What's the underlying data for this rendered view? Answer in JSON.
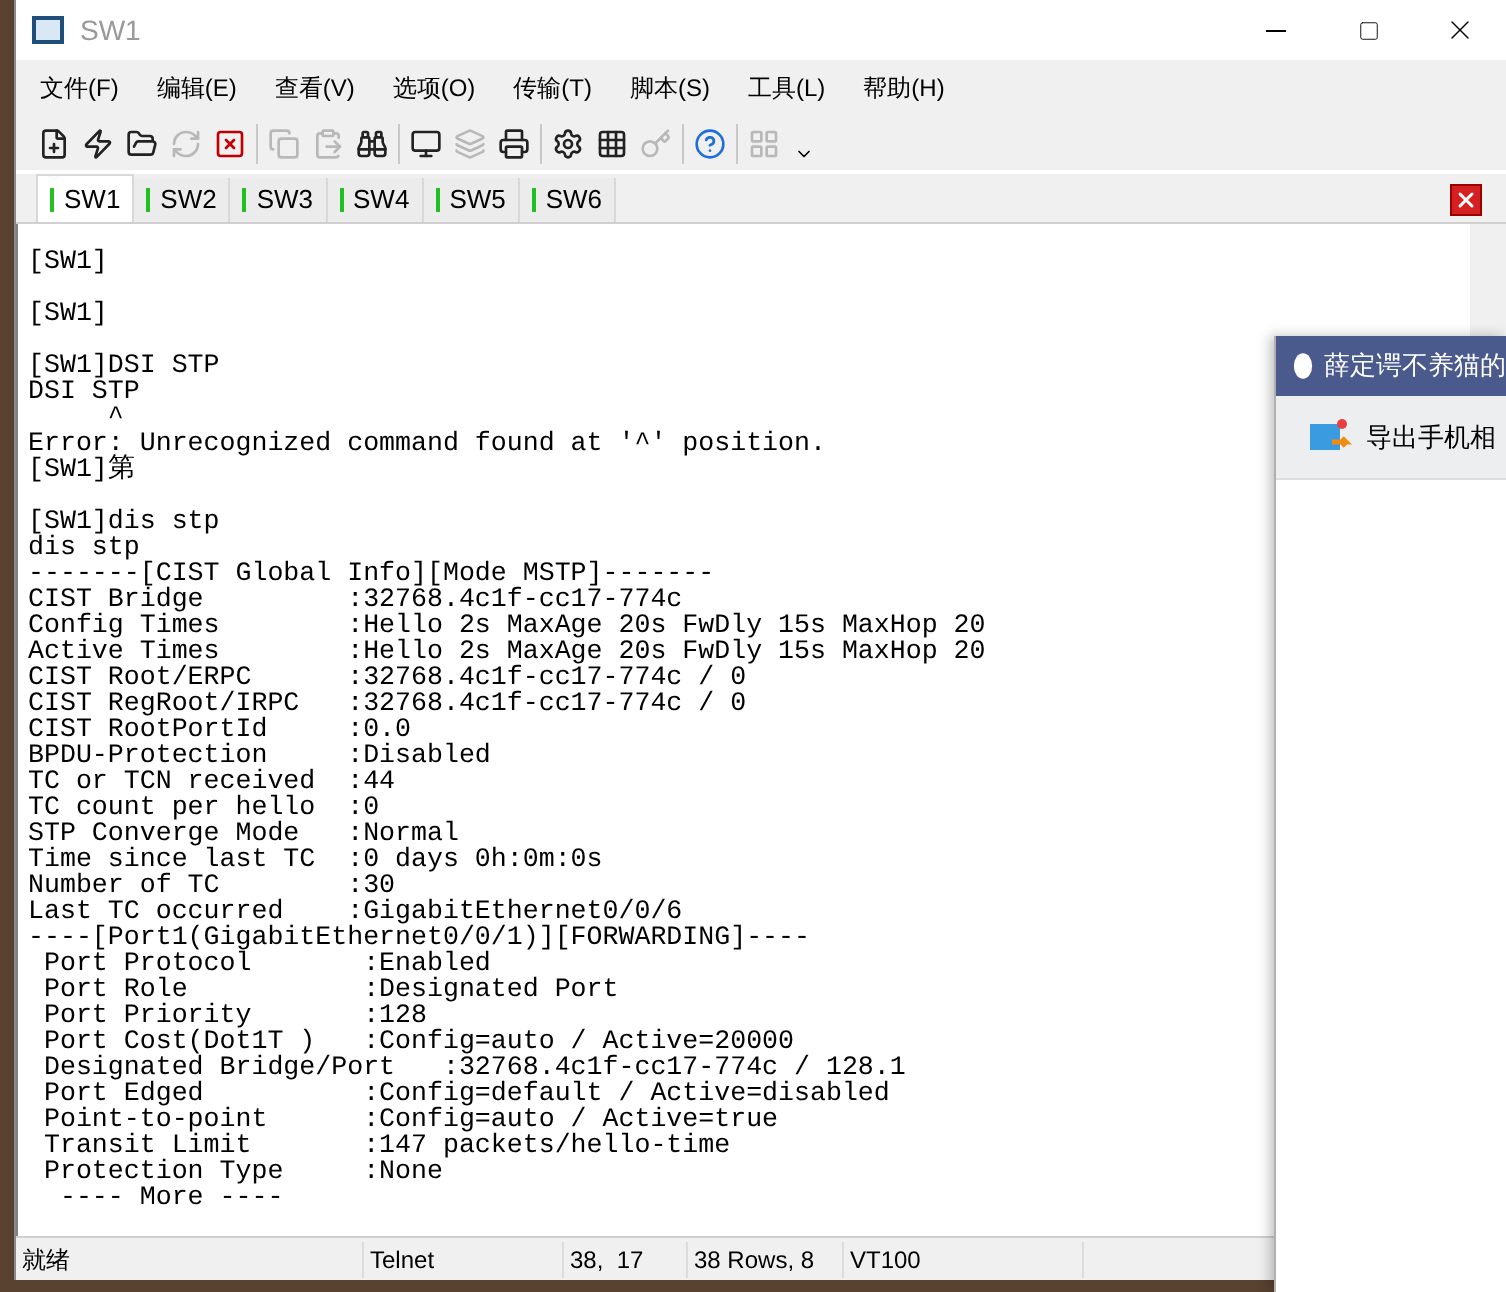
{
  "window": {
    "title": "SW1"
  },
  "menu": [
    "文件(F)",
    "编辑(E)",
    "查看(V)",
    "选项(O)",
    "传输(T)",
    "脚本(S)",
    "工具(L)",
    "帮助(H)"
  ],
  "toolbar": {
    "groups": [
      [
        {
          "disabled": false
        },
        {
          "disabled": false
        },
        {
          "disabled": false
        },
        {
          "disabled": true
        },
        {
          "disabled": false
        }
      ],
      [
        {
          "disabled": true
        },
        {
          "disabled": true
        },
        {
          "disabled": false
        }
      ],
      [
        {
          "disabled": false
        },
        {
          "disabled": true
        },
        {
          "disabled": false
        }
      ],
      [
        {
          "disabled": false
        },
        {
          "disabled": false
        },
        {
          "disabled": true
        }
      ],
      [
        {
          "disabled": false
        }
      ],
      [
        {
          "disabled": true
        }
      ]
    ]
  },
  "tabs": [
    {
      "label": "SW1",
      "selected": true
    },
    {
      "label": "SW2",
      "selected": false
    },
    {
      "label": "SW3",
      "selected": false
    },
    {
      "label": "SW4",
      "selected": false
    },
    {
      "label": "SW5",
      "selected": false
    },
    {
      "label": "SW6",
      "selected": false
    }
  ],
  "terminal": {
    "lines": [
      {
        "kind": "text",
        "text": "[SW1]"
      },
      {
        "kind": "blank"
      },
      {
        "kind": "text",
        "text": "[SW1]"
      },
      {
        "kind": "blank"
      },
      {
        "kind": "text",
        "text": "[SW1]DSI STP"
      },
      {
        "kind": "text",
        "text": "DSI STP"
      },
      {
        "kind": "text",
        "text": "     ^"
      },
      {
        "kind": "text",
        "text": "Error: Unrecognized command found at '^' position."
      },
      {
        "kind": "text",
        "text": "[SW1]第"
      },
      {
        "kind": "blank"
      },
      {
        "kind": "text",
        "text": "[SW1]dis stp"
      },
      {
        "kind": "text",
        "text": "dis stp"
      },
      {
        "kind": "text",
        "text": "-------[CIST Global Info][Mode MSTP]-------"
      },
      {
        "kind": "text",
        "text": "CIST Bridge         :32768.4c1f-cc17-774c"
      },
      {
        "kind": "text",
        "text": "Config Times        :Hello 2s MaxAge 20s FwDly 15s MaxHop 20"
      },
      {
        "kind": "text",
        "text": "Active Times        :Hello 2s MaxAge 20s FwDly 15s MaxHop 20"
      },
      {
        "kind": "text",
        "text": "CIST Root/ERPC      :32768.4c1f-cc17-774c / 0"
      },
      {
        "kind": "text",
        "text": "CIST RegRoot/IRPC   :32768.4c1f-cc17-774c / 0"
      },
      {
        "kind": "text",
        "text": "CIST RootPortId     :0.0"
      },
      {
        "kind": "text",
        "text": "BPDU-Protection     :Disabled"
      },
      {
        "kind": "text",
        "text": "TC or TCN received  :44"
      },
      {
        "kind": "text",
        "text": "TC count per hello  :0"
      },
      {
        "kind": "text",
        "text": "STP Converge Mode   :Normal"
      },
      {
        "kind": "text",
        "text": "Time since last TC  :0 days 0h:0m:0s"
      },
      {
        "kind": "text",
        "text": "Number of TC        :30"
      },
      {
        "kind": "text",
        "text": "Last TC occurred    :GigabitEthernet0/0/6"
      },
      {
        "kind": "text",
        "text": "----[Port1(GigabitEthernet0/0/1)][FORWARDING]----"
      },
      {
        "kind": "text",
        "text": " Port Protocol       :Enabled"
      },
      {
        "kind": "text",
        "text": " Port Role           :Designated Port"
      },
      {
        "kind": "text",
        "text": " Port Priority       :128"
      },
      {
        "kind": "text",
        "text": " Port Cost(Dot1T )   :Config=auto / Active=20000"
      },
      {
        "kind": "text",
        "text": " Designated Bridge/Port   :32768.4c1f-cc17-774c / 128.1"
      },
      {
        "kind": "text",
        "text": " Port Edged          :Config=default / Active=disabled"
      },
      {
        "kind": "text",
        "text": " Point-to-point      :Config=auto / Active=true"
      },
      {
        "kind": "text",
        "text": " Transit Limit       :147 packets/hello-time"
      },
      {
        "kind": "text",
        "text": " Protection Type     :None"
      },
      {
        "kind": "text",
        "text": "  ---- More ----"
      }
    ]
  },
  "status_bar": [
    "就绪",
    "Telnet",
    "38,  17",
    "38 Rows, 8",
    "VT100"
  ],
  "popup": {
    "title": "薛定谔不养猫的",
    "action": "导出手机相"
  }
}
